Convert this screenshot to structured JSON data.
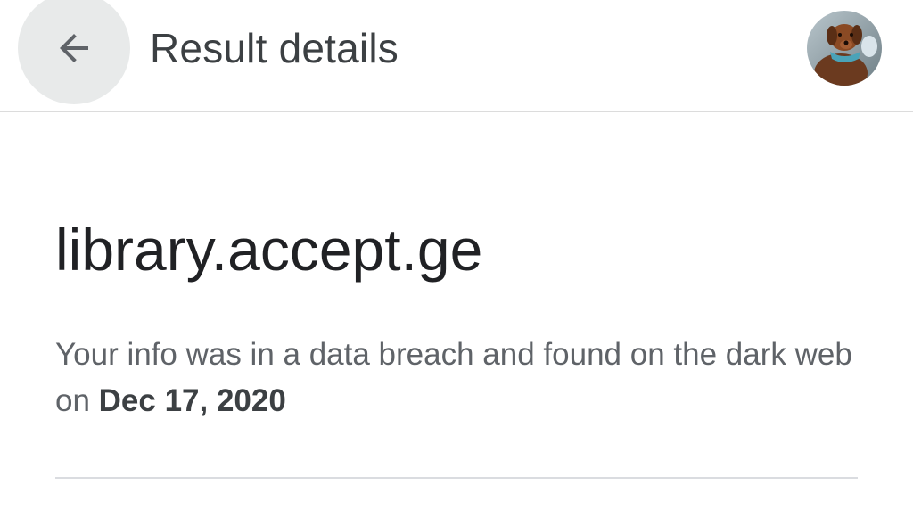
{
  "header": {
    "title": "Result details",
    "back_icon": "arrow-back-icon",
    "avatar_icon": "profile-avatar"
  },
  "result": {
    "site": "library.accept.ge",
    "message_prefix": "Your info was in a data breach and found on the dark web on ",
    "date": "Dec 17, 2020"
  },
  "colors": {
    "title": "#3c4043",
    "site": "#202124",
    "body_text": "#5f6368",
    "divider": "#dadce0",
    "back_button_bg": "#e8eaea"
  }
}
